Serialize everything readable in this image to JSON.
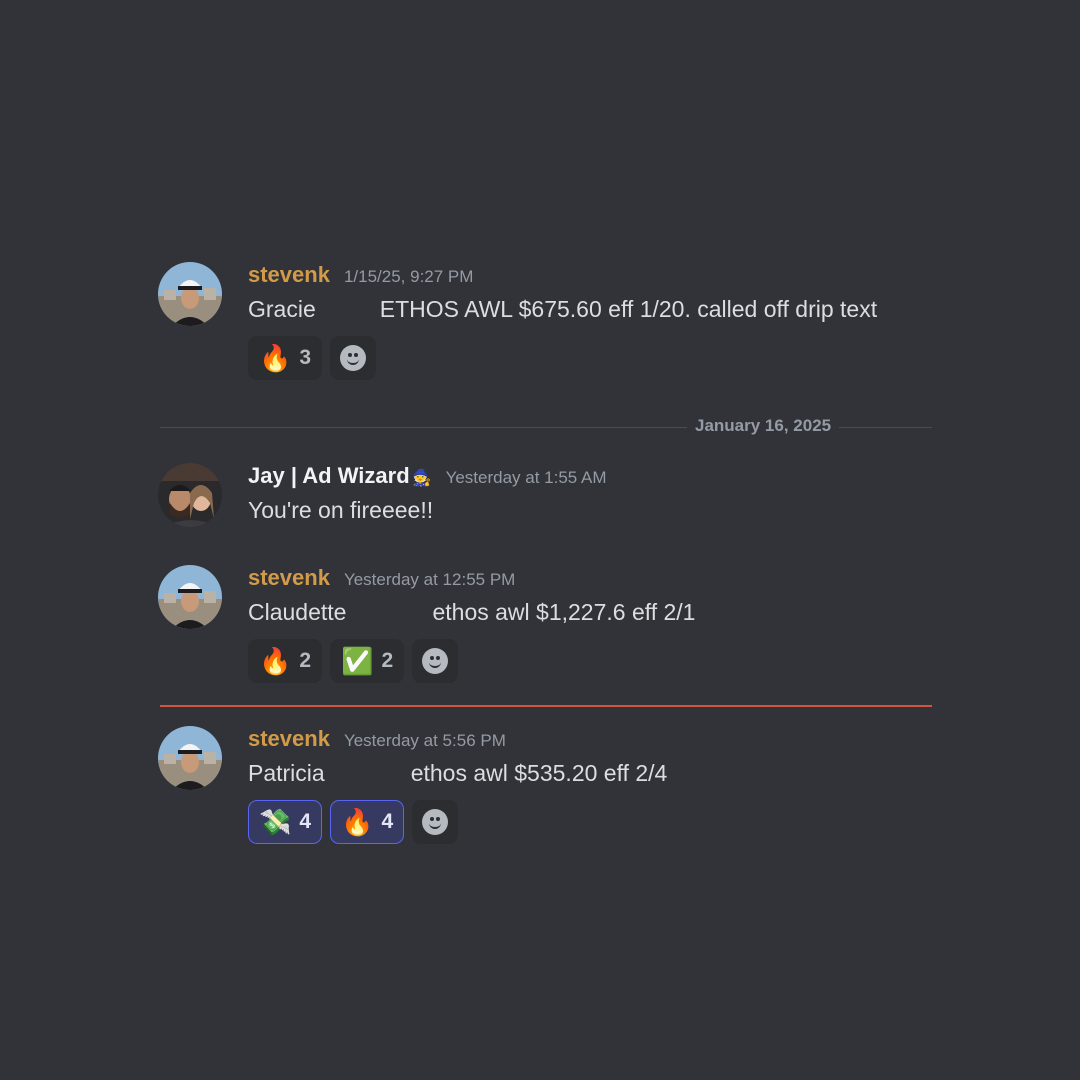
{
  "messages": [
    {
      "author": "stevenk",
      "timestamp": "1/15/25, 9:27 PM",
      "name": "Gracie",
      "text": "ETHOS AWL $675.60 eff 1/20. called off drip text",
      "reactions": [
        {
          "emoji": "🔥",
          "icon": "fire-emoji",
          "count": "3",
          "active": false
        }
      ]
    },
    {
      "author": "Jay | Ad Wizard",
      "author_badge": "🧙",
      "timestamp": "Yesterday at 1:55 AM",
      "text": "You're on fireeee!!"
    },
    {
      "author": "stevenk",
      "timestamp": "Yesterday at 12:55 PM",
      "name": "Claudette",
      "text": "ethos awl $1,227.6 eff 2/1",
      "reactions": [
        {
          "emoji": "🔥",
          "icon": "fire-emoji",
          "count": "2",
          "active": false
        },
        {
          "emoji": "✅",
          "icon": "check-mark-emoji",
          "count": "2",
          "active": false
        }
      ]
    },
    {
      "author": "stevenk",
      "timestamp": "Yesterday at 5:56 PM",
      "name": "Patricia",
      "text": "ethos awl $535.20 eff 2/4",
      "reactions": [
        {
          "emoji": "💸",
          "icon": "money-with-wings-emoji",
          "count": "4",
          "active": true
        },
        {
          "emoji": "🔥",
          "icon": "fire-emoji",
          "count": "4",
          "active": true
        }
      ]
    }
  ],
  "date_divider": "January 16, 2025",
  "colors": {
    "background": "#313338",
    "username_accent": "#d29b4a",
    "new_messages_line": "#d4523f",
    "reaction_active_border": "#5865f2"
  }
}
